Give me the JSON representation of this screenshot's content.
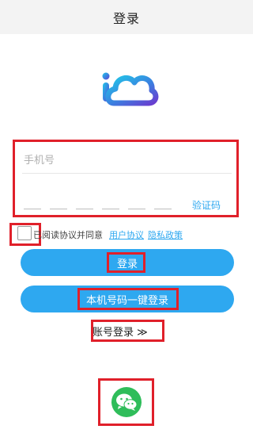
{
  "header": {
    "title": "登录"
  },
  "logo": {
    "icon": "cloud-i-logo-icon"
  },
  "form": {
    "phone_placeholder": "手机号",
    "code_slots": 6,
    "get_code_label": "验证码"
  },
  "agreement": {
    "text": "已阅读协议并同意",
    "user_agreement": "用户协议",
    "privacy_policy": "隐私政策"
  },
  "buttons": {
    "login": "登录",
    "one_click_login": "本机号码一键登录",
    "account_login": "账号登录 ≫"
  },
  "wechat": {
    "icon": "wechat-icon"
  },
  "colors": {
    "accent": "#2ea8f0",
    "highlight": "#e0202a",
    "wechat": "#2fbd5a",
    "header_bg": "#f3f3f3"
  }
}
